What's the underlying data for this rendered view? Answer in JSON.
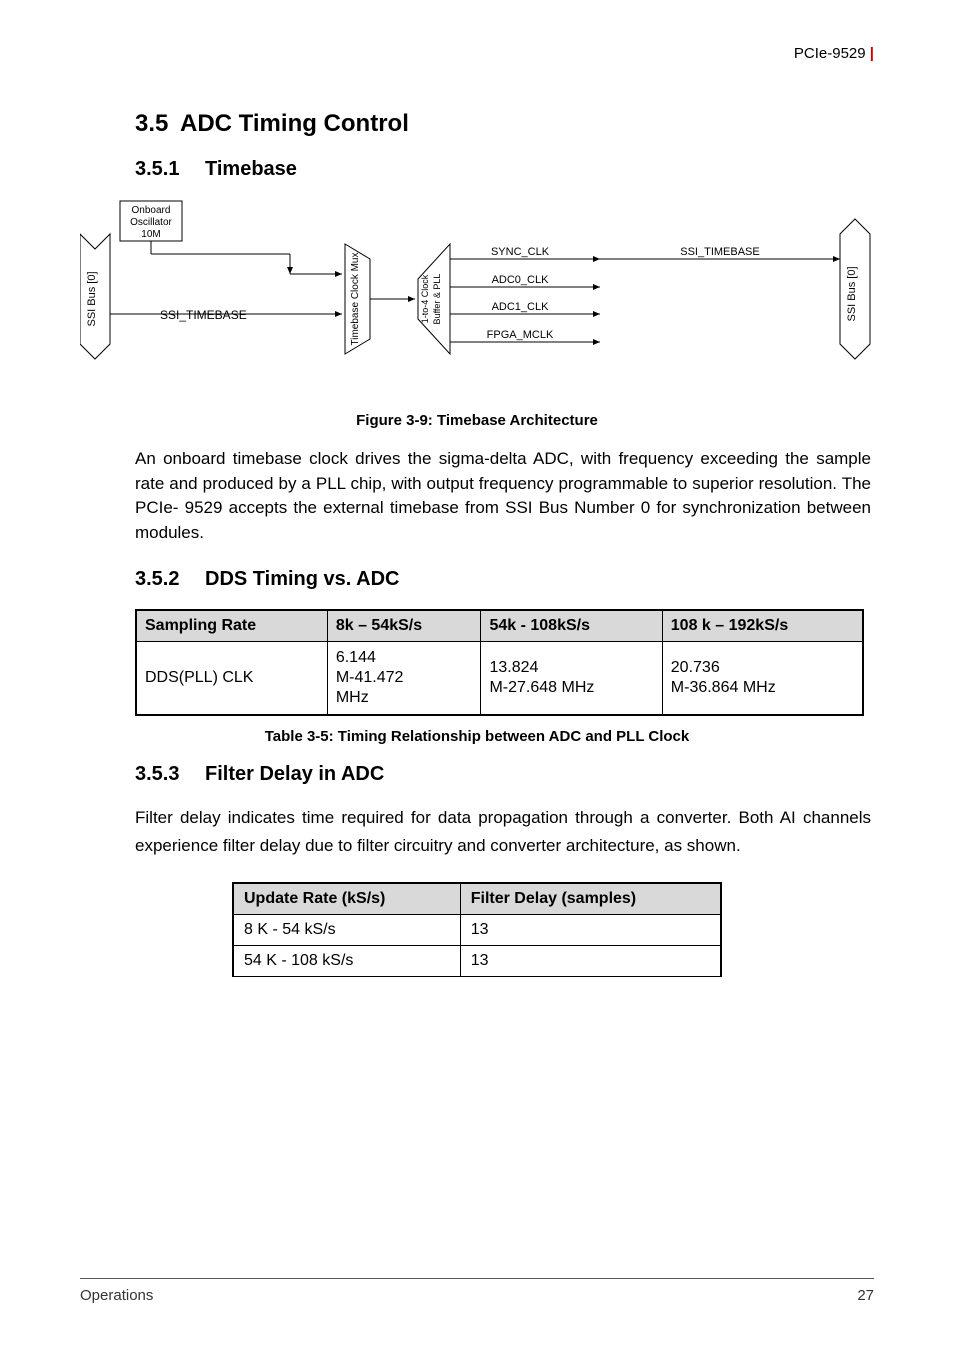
{
  "header": {
    "product": "PCIe-9529"
  },
  "section": {
    "num": "3.5",
    "title": "ADC Timing Control",
    "subs": [
      {
        "num": "3.5.1",
        "title": "Timebase"
      },
      {
        "num": "3.5.2",
        "title": "DDS Timing vs. ADC"
      },
      {
        "num": "3.5.3",
        "title": "Filter Delay in ADC"
      }
    ]
  },
  "diagram": {
    "oscillator": {
      "l1": "Onboard",
      "l2": "Oscillator",
      "l3": "10M"
    },
    "ssi_bus_left": "SSI Bus [0]",
    "ssi_timebase_left": "SSI_TIMEBASE",
    "mux": "Timebase Clock Mux",
    "buffer": {
      "l1": "1-to-4 Clock",
      "l2": "Buffer & PLL"
    },
    "sync_clk": "SYNC_CLK",
    "adc0_clk": "ADC0_CLK",
    "adc1_clk": "ADC1_CLK",
    "fpga_mclk": "FPGA_MCLK",
    "ssi_timebase_right": "SSI_TIMEBASE",
    "ssi_bus_right": "SSI Bus [0]"
  },
  "figure_caption": "Figure 3-9: Timebase Architecture",
  "body1": "An  onboard  timebase clock drives the sigma-delta  ADC, with frequency exceeding the sample rate  and produced by a PLL chip, with output frequency programmable  to superior  resolution.  The PCIe- 9529 accepts the external timebase from SSI Bus Number 0 for synchronization between modules.",
  "timing_table": {
    "headers": [
      "Sampling Rate",
      "8k – 54kS/s",
      "54k - 108kS/s",
      "108 k – 192kS/s"
    ],
    "rowlabel": "DDS(PLL) CLK",
    "cells": [
      "6.144 M-41.472 MHz",
      "13.824 M-27.648 MHz",
      "20.736 M-36.864 MHz"
    ]
  },
  "table_caption": "Table  3-5: Timing Relationship between ADC and PLL Clock",
  "body2": "Filter delay indicates time required for data propagation through  a converter. Both AI channels  experience  filter delay  due  to  filter circuitry  and converter architecture, as shown.",
  "filter_table": {
    "headers": [
      "Update Rate (kS/s)",
      "Filter Delay (samples)"
    ],
    "rows": [
      [
        "8 K - 54 kS/s",
        "13"
      ],
      [
        "54 K - 108 kS/s",
        "13"
      ]
    ]
  },
  "footer": {
    "section_name": "Operations",
    "page": "27"
  }
}
